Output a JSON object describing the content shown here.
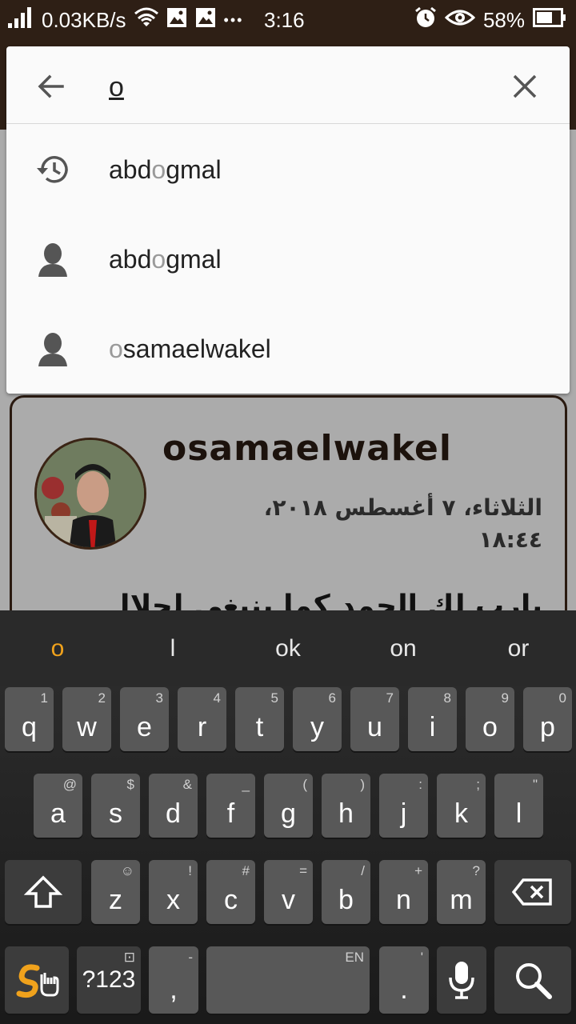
{
  "status_bar": {
    "net_speed": "0.03KB/s",
    "dots": "•••",
    "time": "3:16",
    "battery": "58%"
  },
  "search": {
    "query": "o",
    "suggestions": [
      {
        "icon": "history-icon",
        "pre": "abd",
        "match": "o",
        "post": "gmal"
      },
      {
        "icon": "person-icon",
        "pre": "abd",
        "match": "o",
        "post": "gmal"
      },
      {
        "icon": "person-icon",
        "pre": "",
        "match": "o",
        "post": "samaelwakel"
      }
    ]
  },
  "post": {
    "username": "osamaelwakel",
    "date": "الثلاثاء، ٧ أغسطس ٢٠١٨، ١٨:٤٤",
    "text": "يارب لك الحمد كما ينبغي لجلال"
  },
  "keyboard": {
    "candidates": [
      "o",
      "l",
      "ok",
      "on",
      "or"
    ],
    "row1": [
      {
        "k": "q",
        "s": "1"
      },
      {
        "k": "w",
        "s": "2"
      },
      {
        "k": "e",
        "s": "3"
      },
      {
        "k": "r",
        "s": "4"
      },
      {
        "k": "t",
        "s": "5"
      },
      {
        "k": "y",
        "s": "6"
      },
      {
        "k": "u",
        "s": "7"
      },
      {
        "k": "i",
        "s": "8"
      },
      {
        "k": "o",
        "s": "9"
      },
      {
        "k": "p",
        "s": "0"
      }
    ],
    "row2": [
      {
        "k": "a",
        "s": "@"
      },
      {
        "k": "s",
        "s": "$"
      },
      {
        "k": "d",
        "s": "&"
      },
      {
        "k": "f",
        "s": "_"
      },
      {
        "k": "g",
        "s": "("
      },
      {
        "k": "h",
        "s": ")"
      },
      {
        "k": "j",
        "s": ":"
      },
      {
        "k": "k",
        "s": ";"
      },
      {
        "k": "l",
        "s": "\""
      }
    ],
    "row3": [
      {
        "k": "z",
        "s": "☺"
      },
      {
        "k": "x",
        "s": "!"
      },
      {
        "k": "c",
        "s": "#"
      },
      {
        "k": "v",
        "s": "="
      },
      {
        "k": "b",
        "s": "/"
      },
      {
        "k": "n",
        "s": "+"
      },
      {
        "k": "m",
        "s": "?"
      }
    ],
    "symbols_label": "?123",
    "comma": ",",
    "comma_sub": "-",
    "space_sub": "EN",
    "period": ".",
    "period_sub": "'",
    "accent_color": "#f0a21c"
  }
}
